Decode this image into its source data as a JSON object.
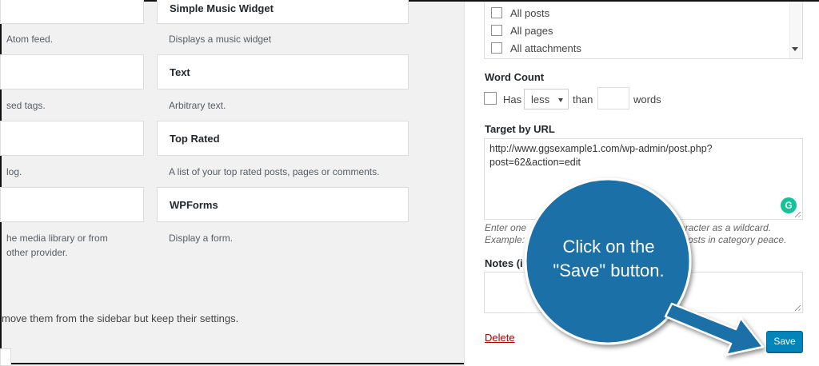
{
  "widgets": [
    {
      "name": "Simple Music Widget",
      "desc": "Displays a music widget"
    },
    {
      "name": "Text",
      "desc": "Arbitrary text."
    },
    {
      "name": "Top Rated",
      "desc": "A list of your top rated posts, pages or comments."
    },
    {
      "name": "WPForms",
      "desc": "Display a form."
    }
  ],
  "left_fragments": {
    "row1": "Atom feed.",
    "row2": "sed tags.",
    "row3": "log.",
    "row4_line1": "he media library or from",
    "row4_line2": "other provider.",
    "bottom_note": "move them from the sidebar but keep their settings."
  },
  "panel": {
    "options": [
      "All posts",
      "All pages",
      "All attachments"
    ],
    "word_count": {
      "title": "Word Count",
      "has": "Has",
      "select_value": "less",
      "than": "than",
      "words": "words"
    },
    "target_url": {
      "title": "Target by URL",
      "line1": "http://www.ggsexample1.com/wp-admin/post.php?",
      "line2": "post=62&action=edit"
    },
    "help_line1_a": "Enter one",
    "help_line1_b": "aracter as a wildcard.",
    "help_line2_a": "Example:",
    "help_line2_b": "osts in category peace.",
    "notes_title": "Notes (i",
    "delete_label": "Delete",
    "save_label": "Save"
  },
  "callout": {
    "line1": "Click on the",
    "line2": "\"Save\" button.",
    "color": "#1e6fa8"
  },
  "colors": {
    "accent": "#0085ba",
    "delete": "#aa0000",
    "grammarly": "#15c39a"
  },
  "icons": {
    "grammarly": "grammarly-icon"
  }
}
